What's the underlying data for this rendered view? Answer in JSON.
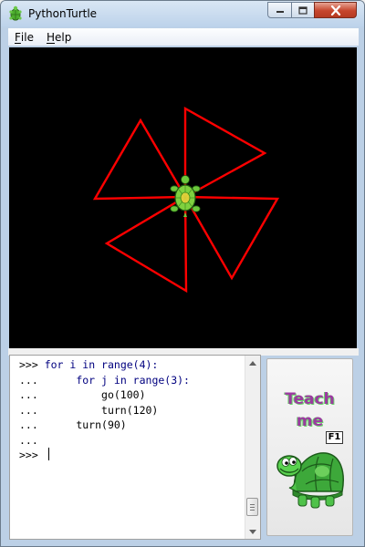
{
  "window": {
    "title": "PythonTurtle",
    "minimize_icon": "minimize-icon",
    "maximize_icon": "maximize-icon",
    "close_icon": "close-icon"
  },
  "menu": {
    "items": [
      {
        "label": "File",
        "mnemonic": "F",
        "rest": "ile"
      },
      {
        "label": "Help",
        "mnemonic": "H",
        "rest": "elp"
      }
    ]
  },
  "canvas": {
    "background": "#000000",
    "line_color": "#ff0000",
    "turtle_icon": "turtle-icon",
    "drawing": "pinwheel of 4 equilateral triangles, side 100, rotated 90 degrees each"
  },
  "shell": {
    "lines": [
      {
        "prompt": ">>> ",
        "indent": "",
        "keyword": "for",
        "code": " i ",
        "kw2": "in",
        "tail": " range(4):"
      },
      {
        "prompt": "...",
        "indent": "      ",
        "keyword": "for",
        "code": " j ",
        "kw2": "in",
        "tail": " range(3):"
      },
      {
        "prompt": "...",
        "indent": "          ",
        "keyword": "",
        "code": "go(100)",
        "kw2": "",
        "tail": ""
      },
      {
        "prompt": "...",
        "indent": "          ",
        "keyword": "",
        "code": "turn(120)",
        "kw2": "",
        "tail": ""
      },
      {
        "prompt": "...",
        "indent": "      ",
        "keyword": "",
        "code": "turn(90)",
        "kw2": "",
        "tail": ""
      },
      {
        "prompt": "...",
        "indent": "",
        "keyword": "",
        "code": "",
        "kw2": "",
        "tail": ""
      },
      {
        "prompt": ">>> ",
        "indent": "",
        "keyword": "",
        "code": "",
        "kw2": "",
        "tail": ""
      }
    ]
  },
  "teach": {
    "line1": "Teach",
    "line2": "me",
    "shortcut": "F1",
    "icon": "teacher-turtle-icon"
  }
}
